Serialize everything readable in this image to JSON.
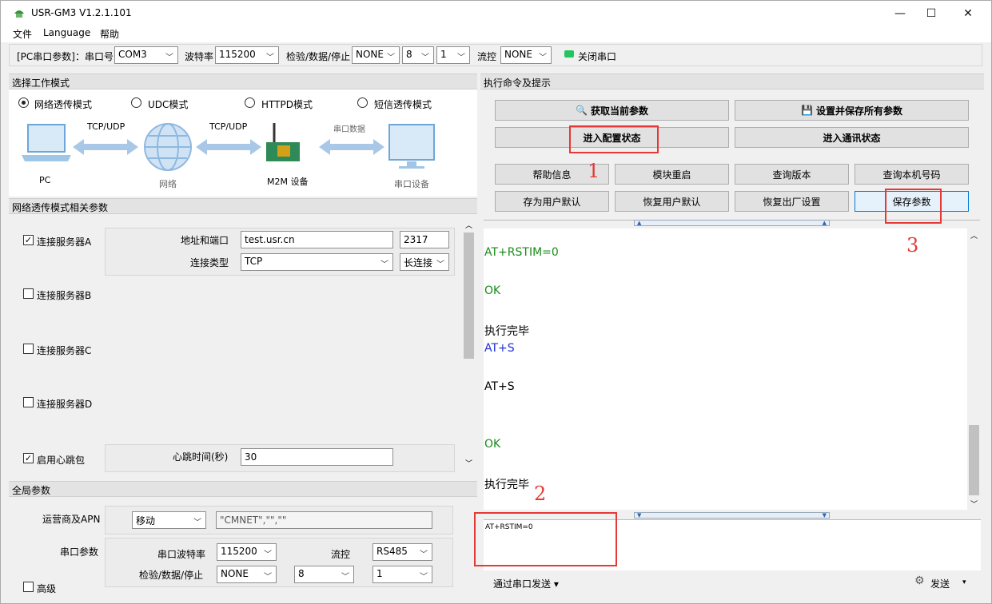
{
  "window": {
    "title": "USR-GM3 V1.2.1.101",
    "minimize": "—",
    "maximize": "☐",
    "close": "✕"
  },
  "menu": [
    "文件",
    "Language",
    "帮助"
  ],
  "serial_bar": {
    "port_label": "[PC串口参数]：串口号",
    "port": "COM3",
    "baud_label": "波特率",
    "baud": "115200",
    "check_label": "检验/数据/停止",
    "parity": "NONE",
    "data_bits": "8",
    "stop_bits": "1",
    "flow_label": "流控",
    "flow": "NONE",
    "close_port": "关闭串口",
    "status_color": "#22c55e"
  },
  "mode_section": {
    "title": "选择工作模式",
    "modes": [
      "网络透传模式",
      "UDC模式",
      "HTTPD模式",
      "短信透传模式"
    ],
    "selected": "网络透传模式",
    "diagram": {
      "pc": "PC",
      "link1": "TCP/UDP",
      "network": "网络",
      "link2": "TCP/UDP",
      "m2m": "M2M 设备",
      "link3": "串口数据",
      "serial_dev": "串口设备"
    }
  },
  "net_params": {
    "title": "网络透传模式相关参数",
    "server_a": {
      "label": "连接服务器A",
      "checked": true,
      "addr_label": "地址和端口",
      "addr": "test.usr.cn",
      "port": "2317",
      "type_label": "连接类型",
      "type": "TCP",
      "conn": "长连接"
    },
    "server_b": {
      "label": "连接服务器B",
      "checked": false
    },
    "server_c": {
      "label": "连接服务器C",
      "checked": false
    },
    "server_d": {
      "label": "连接服务器D",
      "checked": false
    },
    "heartbeat": {
      "label": "启用心跳包",
      "checked": true,
      "time_label": "心跳时间(秒)",
      "time": "30"
    }
  },
  "global_params": {
    "title": "全局参数",
    "apn_label": "运营商及APN",
    "carrier": "移动",
    "apn": "\"CMNET\",\"\",\"\"",
    "serial_label": "串口参数",
    "baud_label": "串口波特率",
    "baud": "115200",
    "flow_label": "流控",
    "flow": "RS485",
    "check_label": "检验/数据/停止",
    "parity": "NONE",
    "data_bits": "8",
    "stop_bits": "1",
    "advanced": "高级"
  },
  "commands": {
    "title": "执行命令及提示",
    "get_params": "获取当前参数",
    "save_all": "设置并保存所有参数",
    "enter_config": "进入配置状态",
    "enter_comm": "进入通讯状态",
    "row1": [
      "帮助信息",
      "模块重启",
      "查询版本",
      "查询本机号码"
    ],
    "row2": [
      "存为用户默认",
      "恢复用户默认",
      "恢复出厂设置",
      "保存参数"
    ]
  },
  "log": [
    {
      "text": "AT+RSTIM=0",
      "color": "#1a8a1a"
    },
    {
      "text": "OK",
      "color": "#1a8a1a"
    },
    {
      "text": "执行完毕",
      "color": "#000000"
    },
    {
      "text": "AT+S",
      "color": "#1e2fd6"
    },
    {
      "text": "AT+S",
      "color": "#000000"
    },
    {
      "text": "OK",
      "color": "#1a8a1a"
    },
    {
      "text": "执行完毕",
      "color": "#000000"
    }
  ],
  "send_box": {
    "text": "AT+RSTIM=0",
    "mode": "通过串口发送 ▾",
    "send": "发送"
  },
  "annotations": [
    "1",
    "2",
    "3"
  ]
}
